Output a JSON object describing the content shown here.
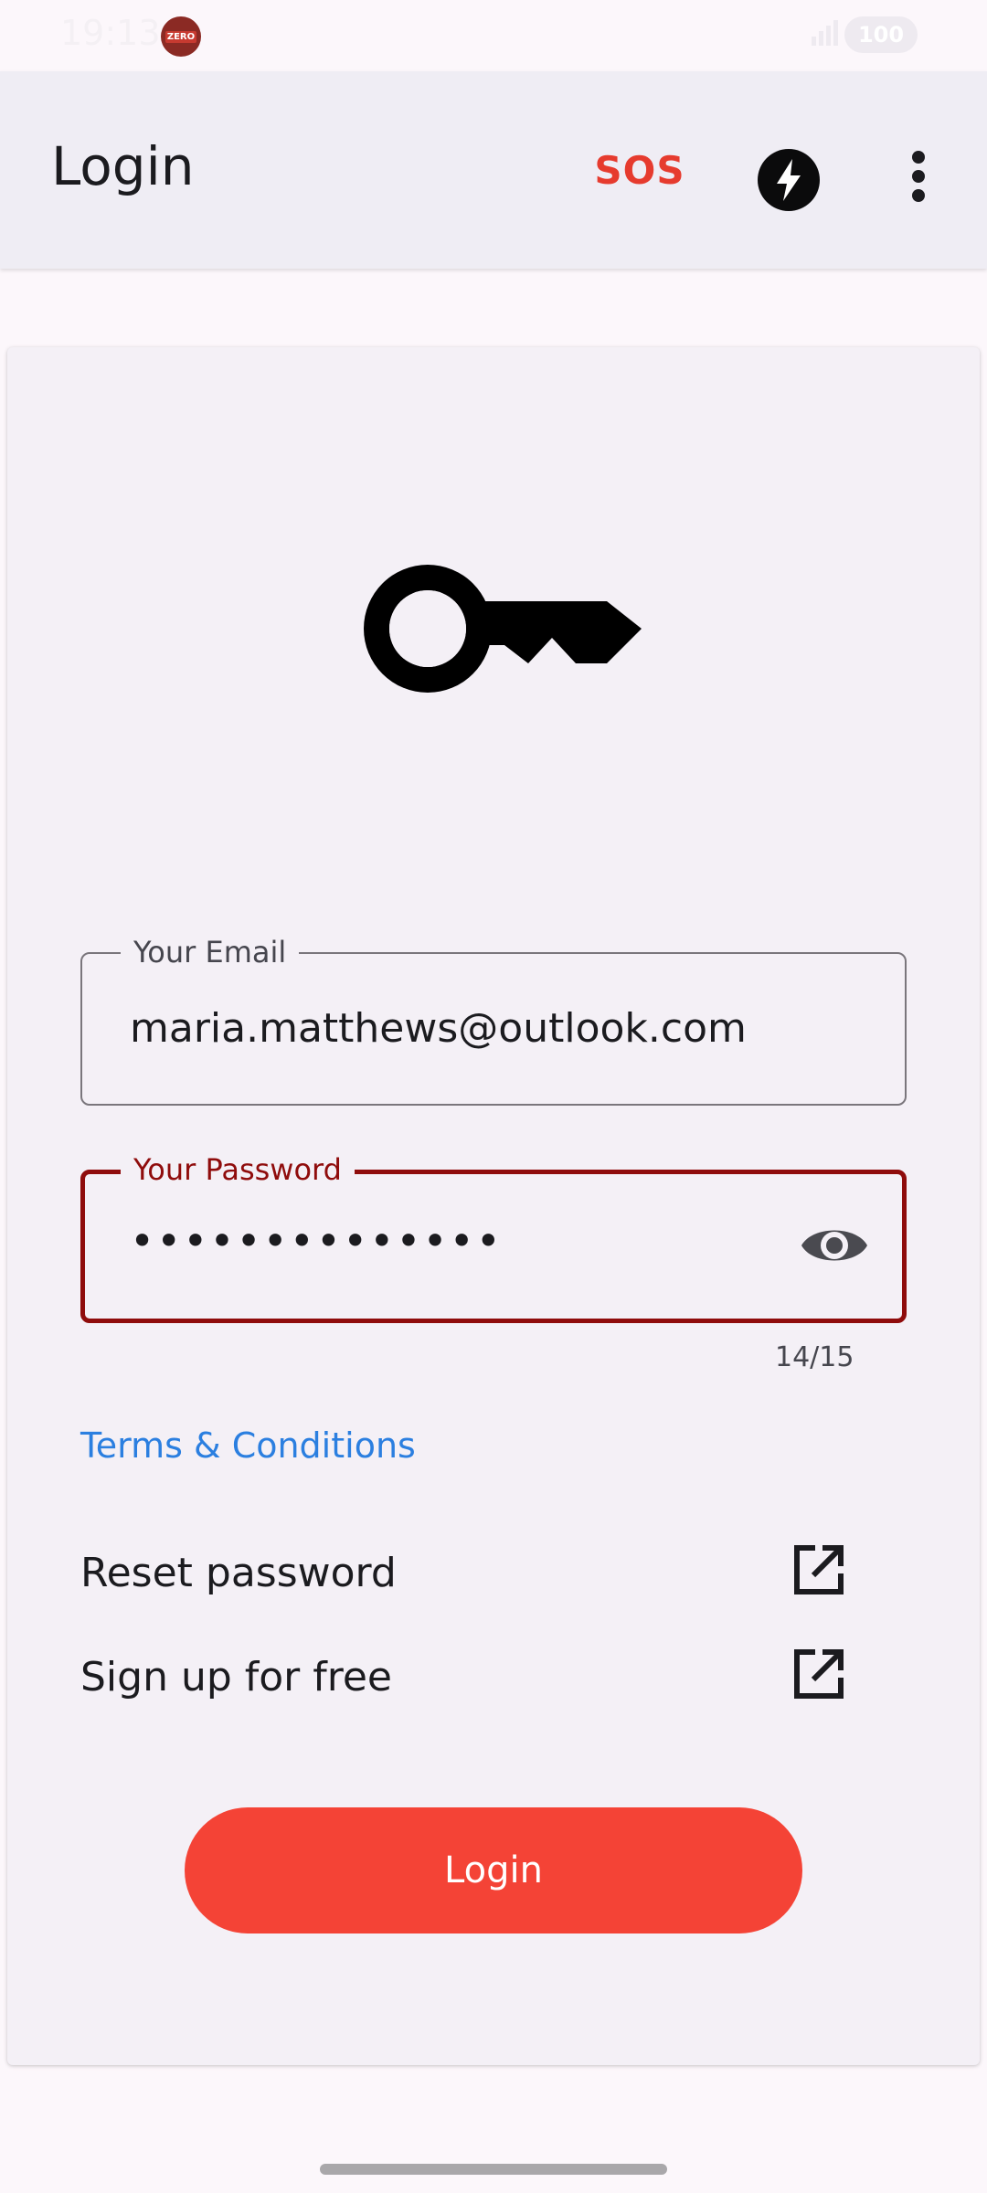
{
  "status_bar": {
    "time": "19:13",
    "app_badge": "ZERO",
    "battery": "100"
  },
  "app_bar": {
    "title": "Login",
    "sos_label": "SOS",
    "flash_icon": "flash-icon",
    "menu_icon": "more-vert-icon"
  },
  "card": {
    "hero_icon": "key-icon",
    "email": {
      "label": "Your Email",
      "value": "maria.matthews@outlook.com"
    },
    "password": {
      "label": "Your Password",
      "value": "••••••••••••••",
      "counter": "14/15",
      "toggle_icon": "eye-icon"
    },
    "terms_link": "Terms & Conditions",
    "links": [
      {
        "label": "Reset password",
        "icon": "open-in-new-icon"
      },
      {
        "label": "Sign up for free",
        "icon": "open-in-new-icon"
      }
    ],
    "login_button": "Login"
  },
  "colors": {
    "accent": "#f44336",
    "error": "#8f0c0c",
    "link": "#2b7fe0",
    "sos": "#e63b2e"
  }
}
